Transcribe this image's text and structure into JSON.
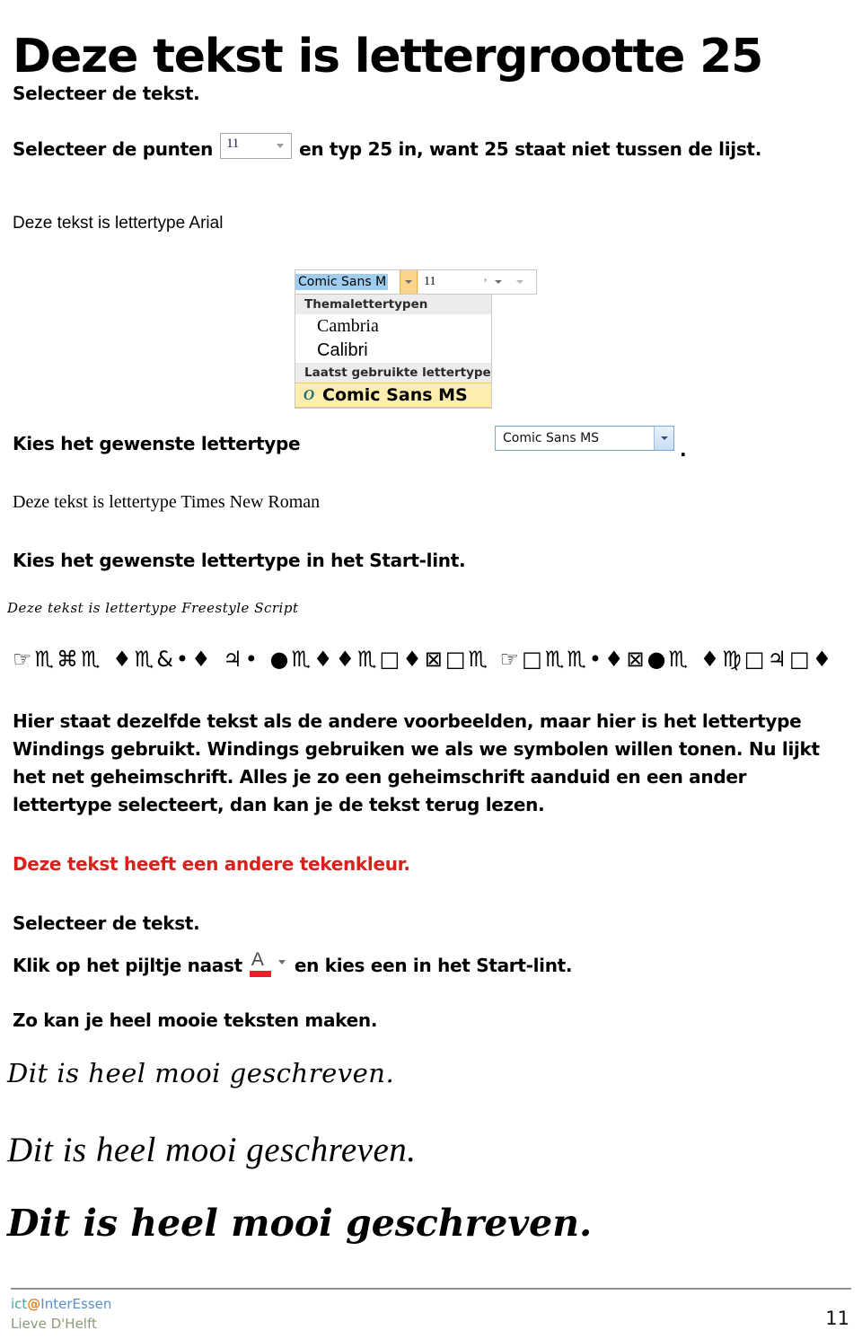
{
  "document": {
    "title": "Deze tekst is lettergrootte 25",
    "lines": {
      "select_text_1": "Selecteer de tekst.",
      "select_points_before": "Selecteer de punten",
      "select_points_after": "en typ 25 in, want 25 staat niet tussen de lijst.",
      "sample_arial": "Deze tekst is lettertype Arial",
      "choose_font_1": "Kies het gewenste lettertype",
      "period_after_combo": ".",
      "sample_times": "Deze tekst is lettertype Times New Roman",
      "choose_font_ribbon": "Kies het gewenste lettertype in het Start-lint.",
      "sample_freestyle": "Deze tekst is lettertype Freestyle Script",
      "wingdings_line": "Deze tekst is lettertype Freestyle Script",
      "paragraph": "Hier staat dezelfde tekst als de andere voorbeelden, maar hier is het lettertype Windings gebruikt. Windings gebruiken we als we symbolen willen tonen. Nu lijkt het net geheimschrift. Alles je zo een geheimschrift aanduid en een ander lettertype selecteert, dan kan je de tekst terug lezen.",
      "red_line": "Deze tekst heeft een andere tekenkleur.",
      "select_text_2": "Selecteer de tekst.",
      "click_arrow_before": "Klik op het pijltje naast",
      "click_arrow_after": "en kies een in het Start-lint.",
      "nice_texts": "Zo kan je heel mooie teksten maken.",
      "script_sample_1": "Dit is heel mooi geschreven.",
      "script_sample_2": "Dit is heel mooi geschreven.",
      "script_sample_3": "Dit is heel mooi geschreven."
    },
    "colors": {
      "red_text": "#d8211b",
      "color_button_bar": "#e8222a",
      "highlight_blue": "#9fcdf0",
      "highlight_yellow": "#fdeeb0",
      "split_button_orange": "#fbd38a"
    }
  },
  "size_combo": {
    "value": "11",
    "caret": "chevron-down-icon"
  },
  "font_picker": {
    "font_name_value": "Comic Sans M",
    "size_value": "11",
    "group_theme_label": "Themalettertypen",
    "theme_fonts": [
      "Cambria",
      "Calibri"
    ],
    "group_recent_label": "Laatst gebruikte lettertype",
    "recent_font": "Comic Sans MS",
    "truetype_icon_glyph": "O"
  },
  "font_combo": {
    "value": "Comic Sans MS",
    "caret": "chevron-down-icon"
  },
  "color_button": {
    "glyph": "A",
    "caret": "chevron-down-icon"
  },
  "wingdings": {
    "glyphs": "☞♏⌘♏   ♦♏&•♦   ♃•   ●♏♦♦♏□♦⊠□♏   ☞□♏♏•♦⊠●♏   ♦♍□♃□♦"
  },
  "footer": {
    "brand_part1": "ict",
    "brand_at": "@",
    "brand_part2": "InterEssen",
    "author": "Lieve D'Helft",
    "page_number": "11"
  }
}
